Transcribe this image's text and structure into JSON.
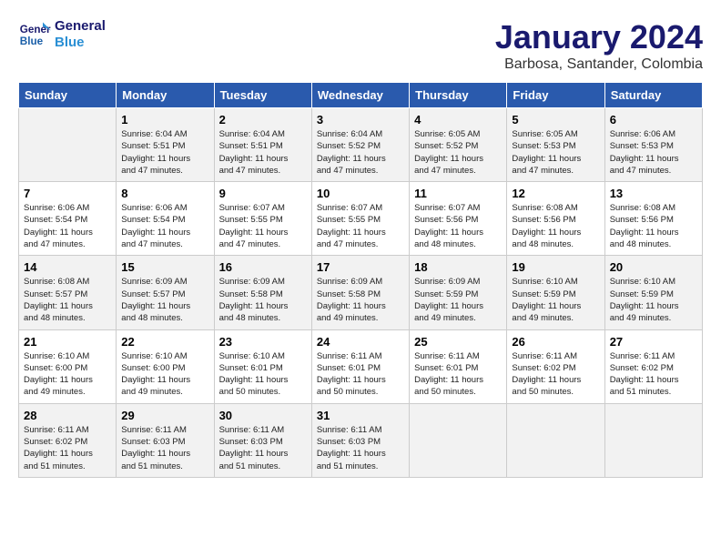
{
  "logo": {
    "line1": "General",
    "line2": "Blue"
  },
  "title": "January 2024",
  "subtitle": "Barbosa, Santander, Colombia",
  "weekdays": [
    "Sunday",
    "Monday",
    "Tuesday",
    "Wednesday",
    "Thursday",
    "Friday",
    "Saturday"
  ],
  "weeks": [
    [
      {
        "day": "",
        "info": ""
      },
      {
        "day": "1",
        "info": "Sunrise: 6:04 AM\nSunset: 5:51 PM\nDaylight: 11 hours\nand 47 minutes."
      },
      {
        "day": "2",
        "info": "Sunrise: 6:04 AM\nSunset: 5:51 PM\nDaylight: 11 hours\nand 47 minutes."
      },
      {
        "day": "3",
        "info": "Sunrise: 6:04 AM\nSunset: 5:52 PM\nDaylight: 11 hours\nand 47 minutes."
      },
      {
        "day": "4",
        "info": "Sunrise: 6:05 AM\nSunset: 5:52 PM\nDaylight: 11 hours\nand 47 minutes."
      },
      {
        "day": "5",
        "info": "Sunrise: 6:05 AM\nSunset: 5:53 PM\nDaylight: 11 hours\nand 47 minutes."
      },
      {
        "day": "6",
        "info": "Sunrise: 6:06 AM\nSunset: 5:53 PM\nDaylight: 11 hours\nand 47 minutes."
      }
    ],
    [
      {
        "day": "7",
        "info": "Sunrise: 6:06 AM\nSunset: 5:54 PM\nDaylight: 11 hours\nand 47 minutes."
      },
      {
        "day": "8",
        "info": "Sunrise: 6:06 AM\nSunset: 5:54 PM\nDaylight: 11 hours\nand 47 minutes."
      },
      {
        "day": "9",
        "info": "Sunrise: 6:07 AM\nSunset: 5:55 PM\nDaylight: 11 hours\nand 47 minutes."
      },
      {
        "day": "10",
        "info": "Sunrise: 6:07 AM\nSunset: 5:55 PM\nDaylight: 11 hours\nand 47 minutes."
      },
      {
        "day": "11",
        "info": "Sunrise: 6:07 AM\nSunset: 5:56 PM\nDaylight: 11 hours\nand 48 minutes."
      },
      {
        "day": "12",
        "info": "Sunrise: 6:08 AM\nSunset: 5:56 PM\nDaylight: 11 hours\nand 48 minutes."
      },
      {
        "day": "13",
        "info": "Sunrise: 6:08 AM\nSunset: 5:56 PM\nDaylight: 11 hours\nand 48 minutes."
      }
    ],
    [
      {
        "day": "14",
        "info": "Sunrise: 6:08 AM\nSunset: 5:57 PM\nDaylight: 11 hours\nand 48 minutes."
      },
      {
        "day": "15",
        "info": "Sunrise: 6:09 AM\nSunset: 5:57 PM\nDaylight: 11 hours\nand 48 minutes."
      },
      {
        "day": "16",
        "info": "Sunrise: 6:09 AM\nSunset: 5:58 PM\nDaylight: 11 hours\nand 48 minutes."
      },
      {
        "day": "17",
        "info": "Sunrise: 6:09 AM\nSunset: 5:58 PM\nDaylight: 11 hours\nand 49 minutes."
      },
      {
        "day": "18",
        "info": "Sunrise: 6:09 AM\nSunset: 5:59 PM\nDaylight: 11 hours\nand 49 minutes."
      },
      {
        "day": "19",
        "info": "Sunrise: 6:10 AM\nSunset: 5:59 PM\nDaylight: 11 hours\nand 49 minutes."
      },
      {
        "day": "20",
        "info": "Sunrise: 6:10 AM\nSunset: 5:59 PM\nDaylight: 11 hours\nand 49 minutes."
      }
    ],
    [
      {
        "day": "21",
        "info": "Sunrise: 6:10 AM\nSunset: 6:00 PM\nDaylight: 11 hours\nand 49 minutes."
      },
      {
        "day": "22",
        "info": "Sunrise: 6:10 AM\nSunset: 6:00 PM\nDaylight: 11 hours\nand 49 minutes."
      },
      {
        "day": "23",
        "info": "Sunrise: 6:10 AM\nSunset: 6:01 PM\nDaylight: 11 hours\nand 50 minutes."
      },
      {
        "day": "24",
        "info": "Sunrise: 6:11 AM\nSunset: 6:01 PM\nDaylight: 11 hours\nand 50 minutes."
      },
      {
        "day": "25",
        "info": "Sunrise: 6:11 AM\nSunset: 6:01 PM\nDaylight: 11 hours\nand 50 minutes."
      },
      {
        "day": "26",
        "info": "Sunrise: 6:11 AM\nSunset: 6:02 PM\nDaylight: 11 hours\nand 50 minutes."
      },
      {
        "day": "27",
        "info": "Sunrise: 6:11 AM\nSunset: 6:02 PM\nDaylight: 11 hours\nand 51 minutes."
      }
    ],
    [
      {
        "day": "28",
        "info": "Sunrise: 6:11 AM\nSunset: 6:02 PM\nDaylight: 11 hours\nand 51 minutes."
      },
      {
        "day": "29",
        "info": "Sunrise: 6:11 AM\nSunset: 6:03 PM\nDaylight: 11 hours\nand 51 minutes."
      },
      {
        "day": "30",
        "info": "Sunrise: 6:11 AM\nSunset: 6:03 PM\nDaylight: 11 hours\nand 51 minutes."
      },
      {
        "day": "31",
        "info": "Sunrise: 6:11 AM\nSunset: 6:03 PM\nDaylight: 11 hours\nand 51 minutes."
      },
      {
        "day": "",
        "info": ""
      },
      {
        "day": "",
        "info": ""
      },
      {
        "day": "",
        "info": ""
      }
    ]
  ]
}
